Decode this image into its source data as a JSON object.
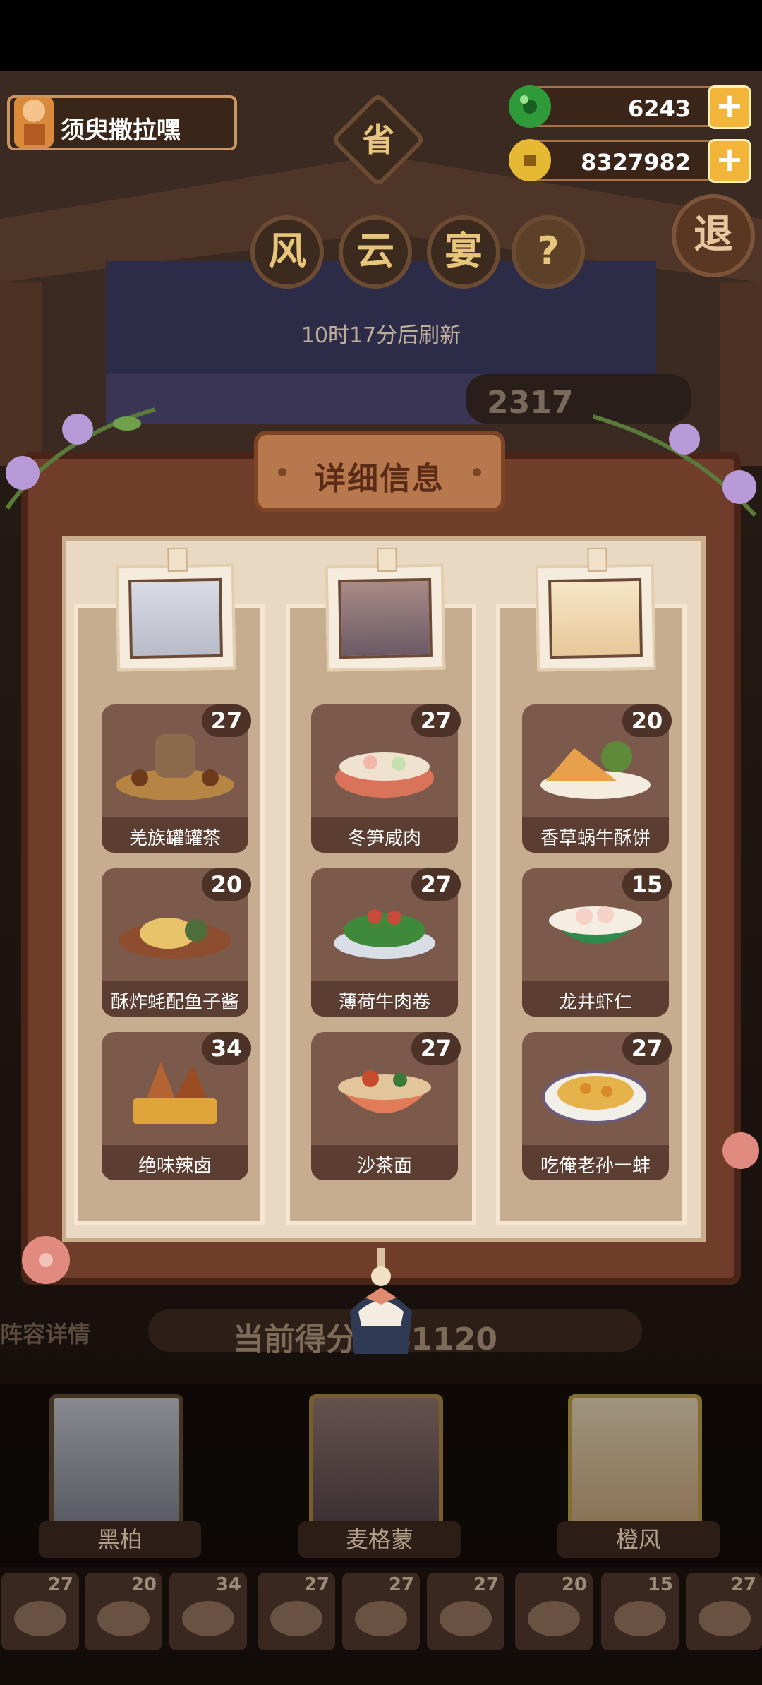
{
  "player": {
    "name": "须臾撒拉嘿"
  },
  "resources": {
    "jade": "6243",
    "coins": "8327982",
    "plus": "+"
  },
  "title_chars": {
    "province": "省",
    "c1": "风",
    "c2": "云",
    "c3": "宴",
    "help": "?"
  },
  "exit_label": "退",
  "refresh_text": "10时17分后刷新",
  "background_number": "2317",
  "panel": {
    "title": "详细信息",
    "columns": [
      {
        "dishes": [
          {
            "name": "羌族罐罐茶",
            "level": "27"
          },
          {
            "name": "酥炸蚝配鱼子酱",
            "level": "20"
          },
          {
            "name": "绝味辣卤",
            "level": "34"
          }
        ]
      },
      {
        "dishes": [
          {
            "name": "冬笋咸肉",
            "level": "27"
          },
          {
            "name": "薄荷牛肉卷",
            "level": "27"
          },
          {
            "name": "沙茶面",
            "level": "27"
          }
        ]
      },
      {
        "dishes": [
          {
            "name": "香草蜗牛酥饼",
            "level": "20"
          },
          {
            "name": "龙井虾仁",
            "level": "15"
          },
          {
            "name": "吃俺老孙一蚌",
            "level": "27"
          }
        ]
      }
    ]
  },
  "bottom": {
    "lineup_label": "阵容详情",
    "score_text": "当前得分 041120",
    "heroes": [
      {
        "name": "黑柏"
      },
      {
        "name": "麦格蒙"
      },
      {
        "name": "橙风"
      }
    ],
    "slots": [
      "27",
      "20",
      "34",
      "27",
      "27",
      "27",
      "20",
      "15",
      "27"
    ]
  },
  "colors": {
    "accent_gold": "#f2b53a",
    "panel_wood": "#6f3d2a",
    "parchment": "#e9d9c2"
  }
}
